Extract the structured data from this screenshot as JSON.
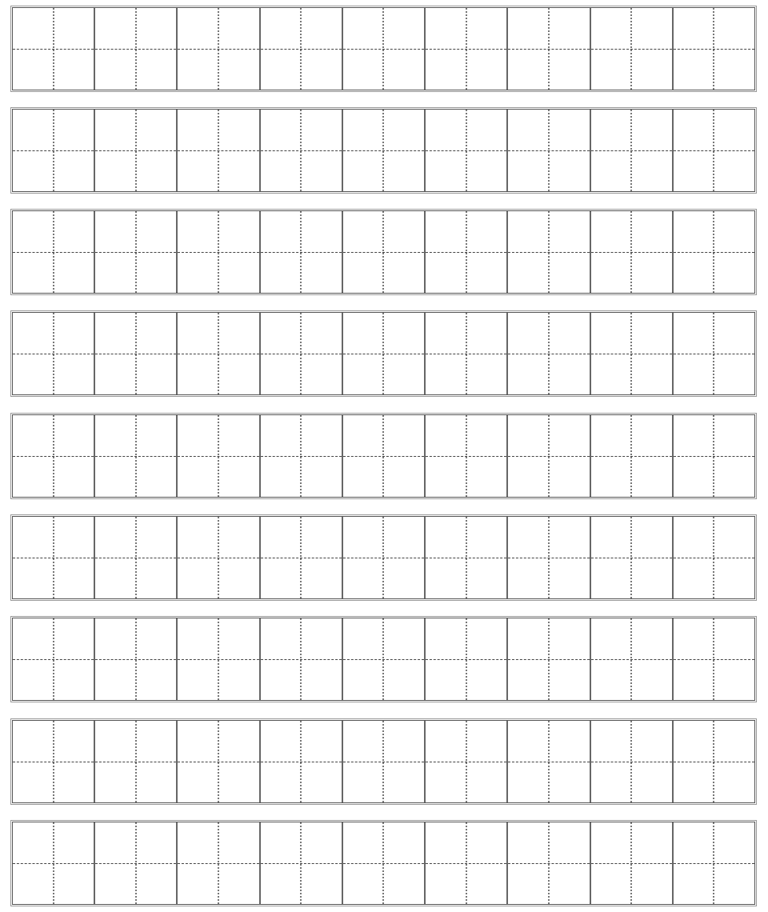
{
  "worksheet": {
    "type": "tianzige-practice-grid",
    "row_count": 9,
    "cells_per_row": 9,
    "guide_style": "dashed-cross",
    "colors": {
      "background": "#ffffff",
      "outer_border": "#555555",
      "cell_divider": "#666666",
      "guide_line": "#444444"
    }
  }
}
